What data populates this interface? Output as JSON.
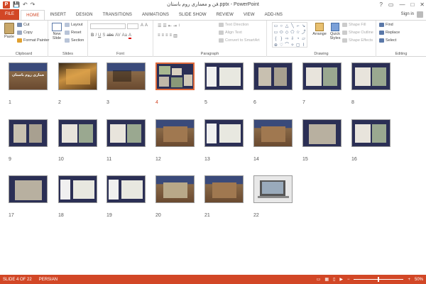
{
  "window": {
    "title": "فن و معماری روم باستان.pptx - PowerPoint",
    "help": "?",
    "controls": [
      "▭",
      "—",
      "□",
      "✕"
    ]
  },
  "quick_access": {
    "app_icon": "P",
    "save": "💾",
    "undo": "↶",
    "redo": "↷"
  },
  "tabs": [
    "FILE",
    "HOME",
    "INSERT",
    "DESIGN",
    "TRANSITIONS",
    "ANIMATIONS",
    "SLIDE SHOW",
    "REVIEW",
    "VIEW",
    "ADD-INS"
  ],
  "active_tab": "HOME",
  "signin": "Sign in",
  "ribbon": {
    "clipboard": {
      "label": "Clipboard",
      "paste": "Paste",
      "cut": "Cut",
      "copy": "Copy",
      "format_painter": "Format Painter"
    },
    "slides": {
      "label": "Slides",
      "new_slide": "New Slide",
      "layout": "Layout",
      "reset": "Reset",
      "section": "Section"
    },
    "font": {
      "label": "Font",
      "bold": "B",
      "italic": "I",
      "underline": "U",
      "strike": "S",
      "abc": "abc",
      "av": "AV",
      "aa": "Aa",
      "a_color": "A"
    },
    "paragraph": {
      "label": "Paragraph",
      "text_direction": "Text Direction",
      "align_text": "Align Text",
      "convert": "Convert to SmartArt"
    },
    "drawing": {
      "label": "Drawing",
      "arrange": "Arrange",
      "quick_styles": "Quick Styles",
      "shape_fill": "Shape Fill",
      "shape_outline": "Shape Outline",
      "shape_effects": "Shape Effects"
    },
    "editing": {
      "label": "Editing",
      "find": "Find",
      "replace": "Replace",
      "select": "Select"
    }
  },
  "slides": [
    {
      "n": "1",
      "kind": "colosseum-title",
      "text": "هنر و معماری روم باستان"
    },
    {
      "n": "2",
      "kind": "photo-warm"
    },
    {
      "n": "3",
      "kind": "colosseum-text"
    },
    {
      "n": "4",
      "kind": "collage",
      "selected": true
    },
    {
      "n": "5",
      "kind": "plan-temple"
    },
    {
      "n": "6",
      "kind": "arch-images"
    },
    {
      "n": "7",
      "kind": "photo-collage"
    },
    {
      "n": "8",
      "kind": "diagram-photo"
    },
    {
      "n": "9",
      "kind": "relief"
    },
    {
      "n": "10",
      "kind": "drawing-photo"
    },
    {
      "n": "11",
      "kind": "diagram-photo"
    },
    {
      "n": "12",
      "kind": "colosseum-photo"
    },
    {
      "n": "13",
      "kind": "plan-drawing"
    },
    {
      "n": "14",
      "kind": "colosseum-photo"
    },
    {
      "n": "15",
      "kind": "pantheon"
    },
    {
      "n": "16",
      "kind": "dome-diagram"
    },
    {
      "n": "17",
      "kind": "interior"
    },
    {
      "n": "18",
      "kind": "plan-ellipse"
    },
    {
      "n": "19",
      "kind": "plan-grid"
    },
    {
      "n": "20",
      "kind": "basilica"
    },
    {
      "n": "21",
      "kind": "colosseum-photo"
    },
    {
      "n": "22",
      "kind": "laptop"
    }
  ],
  "status": {
    "slide": "SLIDE 4 OF 22",
    "language": "PERSIAN",
    "zoom": "50%",
    "zoom_fraction": 0.5
  }
}
